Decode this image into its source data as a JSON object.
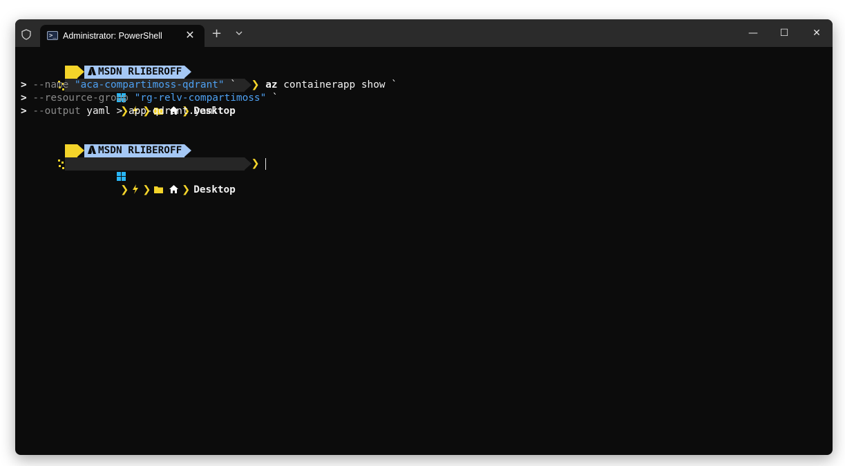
{
  "window": {
    "tab_title": "Administrator: PowerShell",
    "tab_close": "✕",
    "new_tab": "+",
    "minimize": "—",
    "maximize": "☐",
    "close": "✕"
  },
  "prompt": {
    "account": "MSDN RLIBEROFF",
    "folder": "Desktop",
    "prompt_char": "❯"
  },
  "command": {
    "line1": {
      "cmd": "az",
      "rest": " containerapp show `"
    },
    "line2": {
      "prefix": "> ",
      "flag": "--name",
      "value": "\"aca-compartimoss-qdrant\"",
      "tail": " `"
    },
    "line3": {
      "prefix": "> ",
      "flag": "--resource-group",
      "value": "\"rg-relv-compartimoss\"",
      "tail": " `"
    },
    "line4": {
      "prefix": "> ",
      "flag": "--output",
      "rest": " yaml > app-qdrant.yaml"
    }
  },
  "colors": {
    "terminal_bg": "#0c0c0c",
    "titlebar_bg": "#2b2b2b",
    "azure_segment": "#a5c8f5",
    "accent_yellow": "#f4d42a",
    "string_blue": "#4ea1f3"
  },
  "icons": [
    "shield-icon",
    "powershell-icon",
    "chevron-down-icon",
    "azure-icon",
    "windows-icon",
    "lightning-icon",
    "folder-icon",
    "home-icon"
  ]
}
